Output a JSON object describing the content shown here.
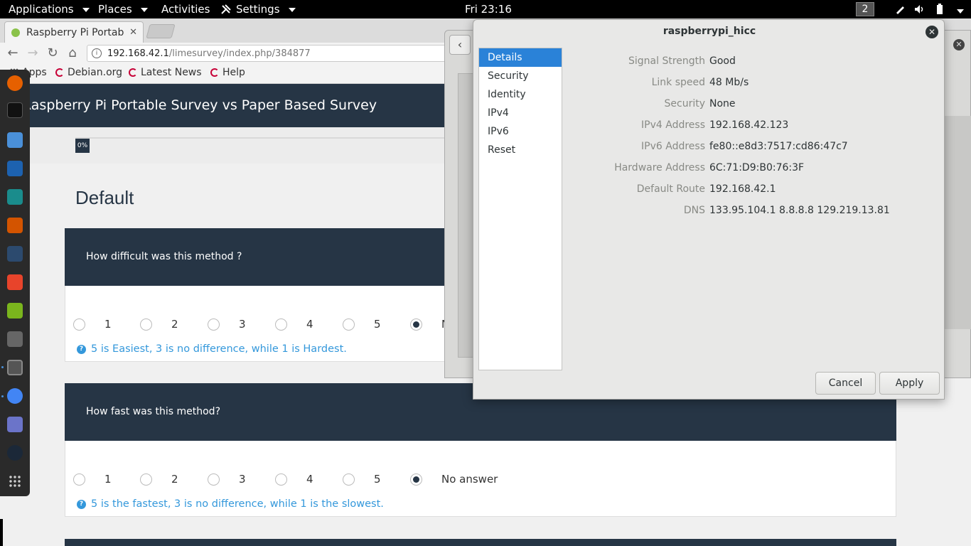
{
  "topbar": {
    "applications": "Applications",
    "places": "Places",
    "activities": "Activities",
    "settings": "Settings",
    "clock": "Fri 23:16",
    "workspace": "2"
  },
  "browser": {
    "tab_title": "Raspberry Pi Portable",
    "url_host": "192.168.42.1",
    "url_path": "/limesurvey/index.php/384877",
    "bookmarks": [
      "Apps",
      "Debian.org",
      "Latest News",
      "Help"
    ]
  },
  "survey": {
    "title": "Raspberry Pi Portable Survey vs Paper Based Survey",
    "progress": "0%",
    "group_title": "Default",
    "questions": [
      {
        "text": "How difficult was this method ?",
        "options": [
          "1",
          "2",
          "3",
          "4",
          "5",
          "N"
        ],
        "selected": "No answer",
        "help": "5 is Easiest, 3 is no difference, while 1 is Hardest."
      },
      {
        "text": "How fast was this method?",
        "options": [
          "1",
          "2",
          "3",
          "4",
          "5",
          "No answer"
        ],
        "selected": "No answer",
        "help": "5 is the fastest, 3 is no difference, while 1 is the slowest."
      }
    ]
  },
  "dialog": {
    "title": "raspberrypi_hicc",
    "sidebar": [
      "Details",
      "Security",
      "Identity",
      "IPv4",
      "IPv6",
      "Reset"
    ],
    "details": [
      {
        "label": "Signal Strength",
        "value": "Good"
      },
      {
        "label": "Link speed",
        "value": "48 Mb/s"
      },
      {
        "label": "Security",
        "value": "None"
      },
      {
        "label": "IPv4 Address",
        "value": "192.168.42.123"
      },
      {
        "label": "IPv6 Address",
        "value": "fe80::e8d3:7517:cd86:47c7"
      },
      {
        "label": "Hardware Address",
        "value": "6C:71:D9:B0:76:3F"
      },
      {
        "label": "Default Route",
        "value": "192.168.42.1"
      },
      {
        "label": "DNS",
        "value": "133.95.104.1 8.8.8.8 129.219.13.81"
      }
    ],
    "cancel": "Cancel",
    "apply": "Apply"
  },
  "colors": {
    "survey_dark": "#263545",
    "help_blue": "#3498db",
    "selection_blue": "#2a82d8"
  }
}
